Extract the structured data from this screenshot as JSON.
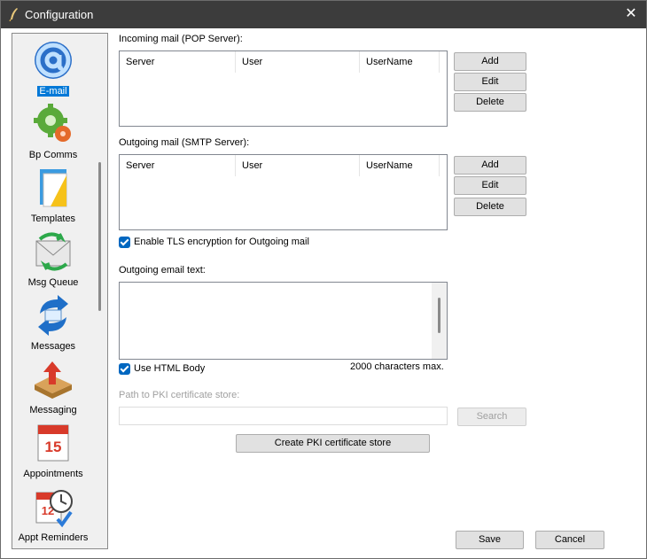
{
  "window": {
    "title": "Configuration",
    "close_glyph": "✕"
  },
  "nav": {
    "items": [
      {
        "label": "E-mail",
        "icon": "email-at-icon",
        "active": true
      },
      {
        "label": "Bp Comms",
        "icon": "gears-icon"
      },
      {
        "label": "Templates",
        "icon": "templates-icon"
      },
      {
        "label": "Msg Queue",
        "icon": "mail-queue-icon"
      },
      {
        "label": "Messages",
        "icon": "messages-sync-icon"
      },
      {
        "label": "Messaging",
        "icon": "inbox-tray-icon"
      },
      {
        "label": "Appointments",
        "icon": "calendar-icon"
      },
      {
        "label": "Appt Reminders",
        "icon": "calendar-clock-icon"
      }
    ],
    "calendar_day": "15",
    "calendar_small_day": "12"
  },
  "incoming": {
    "title": "Incoming mail (POP Server):",
    "columns": [
      "Server",
      "User",
      "UserName"
    ],
    "add": "Add",
    "edit": "Edit",
    "delete": "Delete"
  },
  "outgoing": {
    "title": "Outgoing mail (SMTP Server):",
    "columns": [
      "Server",
      "User",
      "UserName"
    ],
    "add": "Add",
    "edit": "Edit",
    "delete": "Delete"
  },
  "tls": {
    "label": "Enable TLS encryption for Outgoing mail",
    "checked": true
  },
  "email_text": {
    "label": "Outgoing email text:",
    "value": ""
  },
  "html_body": {
    "label": "Use HTML Body",
    "checked": true
  },
  "char_limit": "2000 characters max.",
  "pki": {
    "label": "Path to PKI certificate store:",
    "value": "",
    "search": "Search",
    "create": "Create PKI certificate store"
  },
  "footer": {
    "save": "Save",
    "cancel": "Cancel"
  },
  "colors": {
    "titlebar": "#3c3c3c",
    "accent": "#0078d7",
    "checkbox": "#0067c0"
  }
}
